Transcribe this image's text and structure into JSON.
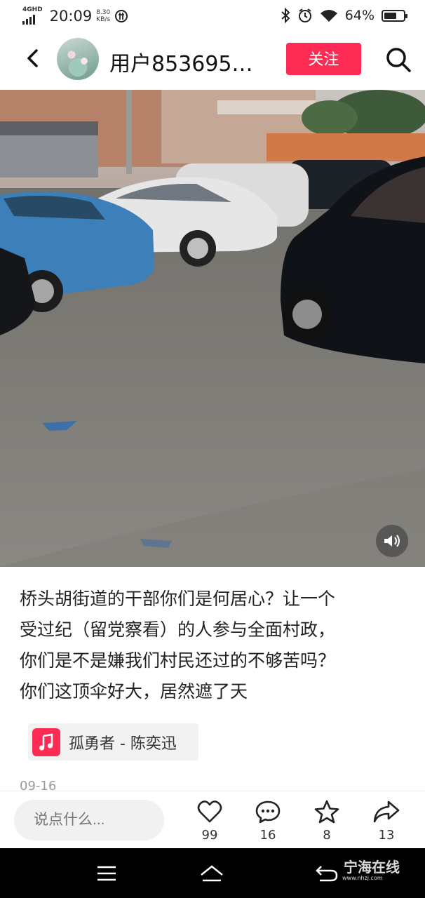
{
  "status_bar": {
    "network": "4GHD",
    "time": "20:09",
    "speed_value": "8.30",
    "speed_unit": "KB/s",
    "battery_percent": "64%",
    "battery_level": 0.64
  },
  "header": {
    "username": "用户853695…",
    "follow_label": "关注"
  },
  "post": {
    "caption_lines": [
      "桥头胡街道的干部你们是何居心？让一个",
      "受过纪（留党察看）的人参与全面村政，",
      "你们是不是嫌我们村民还过的不够苦吗？",
      "你们这顶伞好大，居然遮了天"
    ],
    "music_title": "孤勇者 - 陈奕迅",
    "date": "09-16"
  },
  "actions": {
    "comment_placeholder": "说点什么...",
    "likes": "99",
    "comments": "16",
    "favorites": "8",
    "shares": "13"
  },
  "watermark": {
    "text": "宁海在线",
    "url": "www.nhzj.com"
  },
  "colors": {
    "accent": "#fe2c55"
  }
}
